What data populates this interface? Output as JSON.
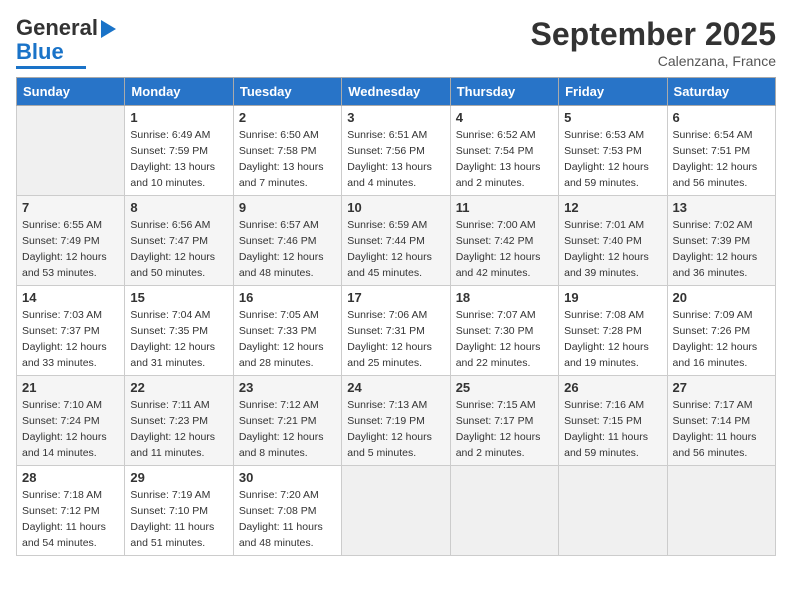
{
  "logo": {
    "text1": "General",
    "text2": "Blue"
  },
  "title": "September 2025",
  "location": "Calenzana, France",
  "days_header": [
    "Sunday",
    "Monday",
    "Tuesday",
    "Wednesday",
    "Thursday",
    "Friday",
    "Saturday"
  ],
  "weeks": [
    [
      {
        "num": "",
        "info": ""
      },
      {
        "num": "1",
        "info": "Sunrise: 6:49 AM\nSunset: 7:59 PM\nDaylight: 13 hours\nand 10 minutes."
      },
      {
        "num": "2",
        "info": "Sunrise: 6:50 AM\nSunset: 7:58 PM\nDaylight: 13 hours\nand 7 minutes."
      },
      {
        "num": "3",
        "info": "Sunrise: 6:51 AM\nSunset: 7:56 PM\nDaylight: 13 hours\nand 4 minutes."
      },
      {
        "num": "4",
        "info": "Sunrise: 6:52 AM\nSunset: 7:54 PM\nDaylight: 13 hours\nand 2 minutes."
      },
      {
        "num": "5",
        "info": "Sunrise: 6:53 AM\nSunset: 7:53 PM\nDaylight: 12 hours\nand 59 minutes."
      },
      {
        "num": "6",
        "info": "Sunrise: 6:54 AM\nSunset: 7:51 PM\nDaylight: 12 hours\nand 56 minutes."
      }
    ],
    [
      {
        "num": "7",
        "info": "Sunrise: 6:55 AM\nSunset: 7:49 PM\nDaylight: 12 hours\nand 53 minutes."
      },
      {
        "num": "8",
        "info": "Sunrise: 6:56 AM\nSunset: 7:47 PM\nDaylight: 12 hours\nand 50 minutes."
      },
      {
        "num": "9",
        "info": "Sunrise: 6:57 AM\nSunset: 7:46 PM\nDaylight: 12 hours\nand 48 minutes."
      },
      {
        "num": "10",
        "info": "Sunrise: 6:59 AM\nSunset: 7:44 PM\nDaylight: 12 hours\nand 45 minutes."
      },
      {
        "num": "11",
        "info": "Sunrise: 7:00 AM\nSunset: 7:42 PM\nDaylight: 12 hours\nand 42 minutes."
      },
      {
        "num": "12",
        "info": "Sunrise: 7:01 AM\nSunset: 7:40 PM\nDaylight: 12 hours\nand 39 minutes."
      },
      {
        "num": "13",
        "info": "Sunrise: 7:02 AM\nSunset: 7:39 PM\nDaylight: 12 hours\nand 36 minutes."
      }
    ],
    [
      {
        "num": "14",
        "info": "Sunrise: 7:03 AM\nSunset: 7:37 PM\nDaylight: 12 hours\nand 33 minutes."
      },
      {
        "num": "15",
        "info": "Sunrise: 7:04 AM\nSunset: 7:35 PM\nDaylight: 12 hours\nand 31 minutes."
      },
      {
        "num": "16",
        "info": "Sunrise: 7:05 AM\nSunset: 7:33 PM\nDaylight: 12 hours\nand 28 minutes."
      },
      {
        "num": "17",
        "info": "Sunrise: 7:06 AM\nSunset: 7:31 PM\nDaylight: 12 hours\nand 25 minutes."
      },
      {
        "num": "18",
        "info": "Sunrise: 7:07 AM\nSunset: 7:30 PM\nDaylight: 12 hours\nand 22 minutes."
      },
      {
        "num": "19",
        "info": "Sunrise: 7:08 AM\nSunset: 7:28 PM\nDaylight: 12 hours\nand 19 minutes."
      },
      {
        "num": "20",
        "info": "Sunrise: 7:09 AM\nSunset: 7:26 PM\nDaylight: 12 hours\nand 16 minutes."
      }
    ],
    [
      {
        "num": "21",
        "info": "Sunrise: 7:10 AM\nSunset: 7:24 PM\nDaylight: 12 hours\nand 14 minutes."
      },
      {
        "num": "22",
        "info": "Sunrise: 7:11 AM\nSunset: 7:23 PM\nDaylight: 12 hours\nand 11 minutes."
      },
      {
        "num": "23",
        "info": "Sunrise: 7:12 AM\nSunset: 7:21 PM\nDaylight: 12 hours\nand 8 minutes."
      },
      {
        "num": "24",
        "info": "Sunrise: 7:13 AM\nSunset: 7:19 PM\nDaylight: 12 hours\nand 5 minutes."
      },
      {
        "num": "25",
        "info": "Sunrise: 7:15 AM\nSunset: 7:17 PM\nDaylight: 12 hours\nand 2 minutes."
      },
      {
        "num": "26",
        "info": "Sunrise: 7:16 AM\nSunset: 7:15 PM\nDaylight: 11 hours\nand 59 minutes."
      },
      {
        "num": "27",
        "info": "Sunrise: 7:17 AM\nSunset: 7:14 PM\nDaylight: 11 hours\nand 56 minutes."
      }
    ],
    [
      {
        "num": "28",
        "info": "Sunrise: 7:18 AM\nSunset: 7:12 PM\nDaylight: 11 hours\nand 54 minutes."
      },
      {
        "num": "29",
        "info": "Sunrise: 7:19 AM\nSunset: 7:10 PM\nDaylight: 11 hours\nand 51 minutes."
      },
      {
        "num": "30",
        "info": "Sunrise: 7:20 AM\nSunset: 7:08 PM\nDaylight: 11 hours\nand 48 minutes."
      },
      {
        "num": "",
        "info": ""
      },
      {
        "num": "",
        "info": ""
      },
      {
        "num": "",
        "info": ""
      },
      {
        "num": "",
        "info": ""
      }
    ]
  ]
}
